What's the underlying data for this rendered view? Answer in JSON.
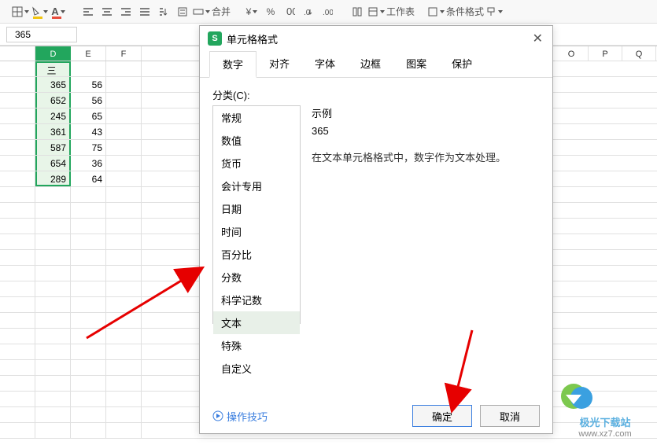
{
  "toolbar": {
    "merge_label": "合并",
    "worksheet_label": "工作表",
    "conditional_label": "条件格式",
    "currency_symbol": "¥",
    "percent_symbol": "%"
  },
  "formula_bar": {
    "value": "365"
  },
  "sheet": {
    "col_headers_left": [
      "",
      "D",
      "E",
      "F"
    ],
    "col_headers_right": [
      "O",
      "P",
      "Q"
    ],
    "row_header": "三",
    "data": [
      [
        "365",
        "56"
      ],
      [
        "652",
        "56"
      ],
      [
        "245",
        "65"
      ],
      [
        "361",
        "43"
      ],
      [
        "587",
        "75"
      ],
      [
        "654",
        "36"
      ],
      [
        "289",
        "64"
      ]
    ]
  },
  "dialog": {
    "title": "单元格格式",
    "tabs": [
      "数字",
      "对齐",
      "字体",
      "边框",
      "图案",
      "保护"
    ],
    "active_tab_index": 0,
    "category_label": "分类(C):",
    "categories": [
      "常规",
      "数值",
      "货币",
      "会计专用",
      "日期",
      "时间",
      "百分比",
      "分数",
      "科学记数",
      "文本",
      "特殊",
      "自定义"
    ],
    "selected_category_index": 9,
    "example_label": "示例",
    "example_value": "365",
    "description": "在文本单元格格式中，数字作为文本处理。",
    "tips_label": "操作技巧",
    "ok_label": "确定",
    "cancel_label": "取消"
  },
  "watermark": {
    "brand": "极光下载站",
    "url": "www.xz7.com"
  }
}
